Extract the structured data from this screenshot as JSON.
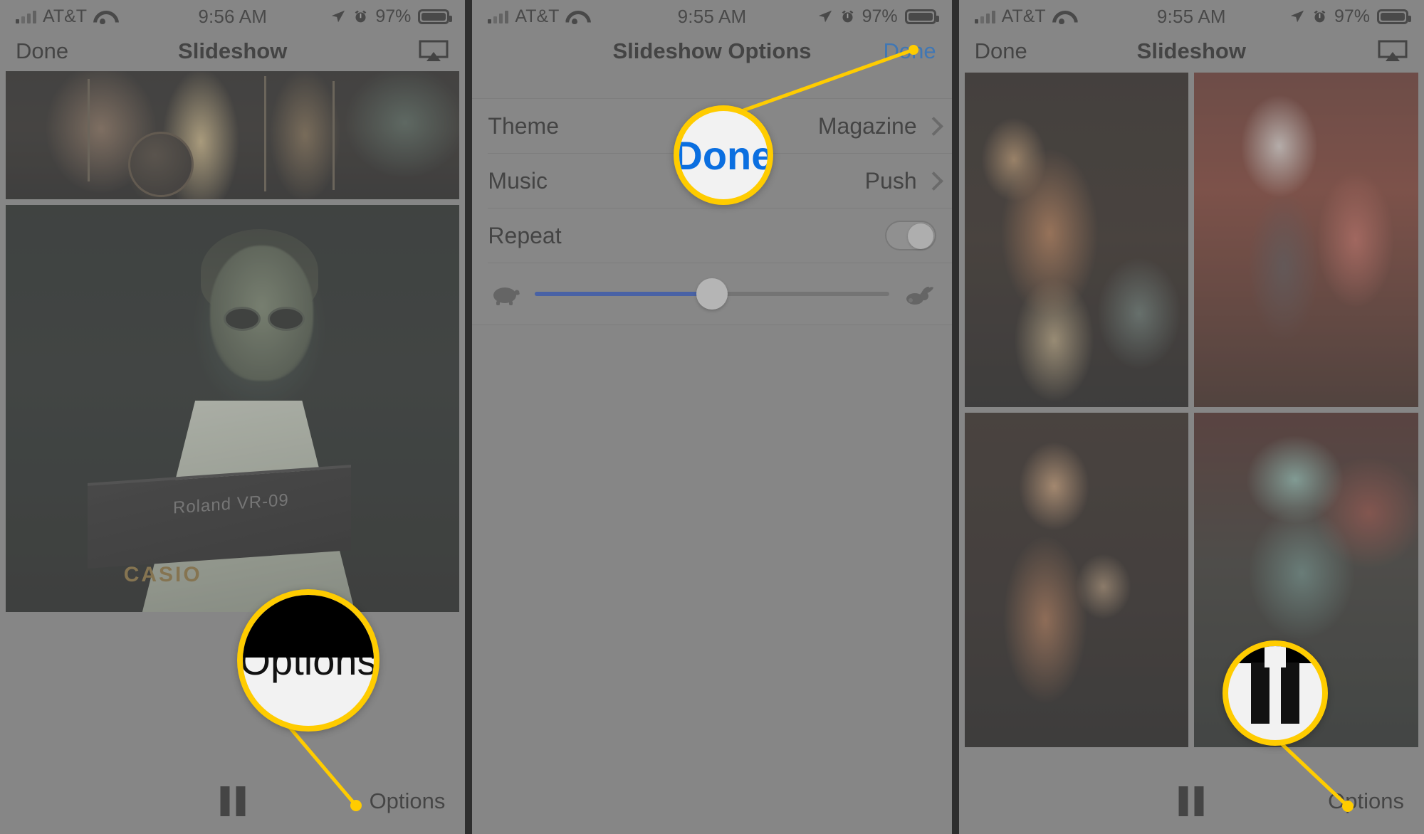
{
  "accent": {
    "callout_yellow": "#FFCC00",
    "ios_blue": "#0b6fe0",
    "slider_blue": "#1a49c4"
  },
  "panels": [
    {
      "id": "slideshow-playing",
      "status_bar": {
        "carrier": "AT&T",
        "time": "9:56 AM",
        "battery_percent": "97%",
        "icons": [
          "signal-bars-icon",
          "wifi-icon",
          "location-arrow-icon",
          "alarm-clock-icon",
          "battery-icon"
        ]
      },
      "nav": {
        "left_label": "Done",
        "title": "Slideshow",
        "right_icon": "airplay-icon"
      },
      "photos": [
        {
          "name": "band-on-stage-photo",
          "caption": ""
        },
        {
          "name": "keyboardist-photo",
          "caption": "Roland  VR-09",
          "secondary_caption": "CASIO"
        }
      ],
      "toolbar": {
        "pause_icon": "pause-icon",
        "options_label": "Options"
      },
      "callout": {
        "text": "Options",
        "target": "options-button"
      }
    },
    {
      "id": "slideshow-options",
      "status_bar": {
        "carrier": "AT&T",
        "time": "9:55 AM",
        "battery_percent": "97%",
        "icons": [
          "signal-bars-icon",
          "wifi-icon",
          "location-arrow-icon",
          "alarm-clock-icon",
          "battery-icon"
        ]
      },
      "nav": {
        "left_label": "",
        "title": "Slideshow Options",
        "right_label": "Done"
      },
      "rows": [
        {
          "name": "theme-row",
          "label": "Theme",
          "value": "Magazine",
          "control": "disclosure-chevron"
        },
        {
          "name": "music-row",
          "label": "Music",
          "value": "Push",
          "control": "disclosure-chevron"
        },
        {
          "name": "repeat-row",
          "label": "Repeat",
          "value": "",
          "control": "toggle-off"
        }
      ],
      "speed_slider": {
        "name": "slideshow-speed-slider",
        "left_icon": "turtle-icon",
        "right_icon": "rabbit-icon",
        "value_percent": 50
      },
      "callout": {
        "text": "Done",
        "target": "done-button"
      }
    },
    {
      "id": "slideshow-grid",
      "status_bar": {
        "carrier": "AT&T",
        "time": "9:55 AM",
        "battery_percent": "97%",
        "icons": [
          "signal-bars-icon",
          "wifi-icon",
          "location-arrow-icon",
          "alarm-clock-icon",
          "battery-icon"
        ]
      },
      "nav": {
        "left_label": "Done",
        "title": "Slideshow",
        "right_icon": "airplay-icon"
      },
      "grid_photos": [
        {
          "name": "singer-arms-raised-photo"
        },
        {
          "name": "white-hair-singer-keyboard-photo"
        },
        {
          "name": "singer-at-mic-photo"
        },
        {
          "name": "teal-lit-singer-photo"
        }
      ],
      "toolbar": {
        "pause_icon": "pause-icon",
        "options_label": "Options"
      },
      "callout": {
        "text": "",
        "icon": "pause-icon",
        "target": "pause-button"
      }
    }
  ]
}
